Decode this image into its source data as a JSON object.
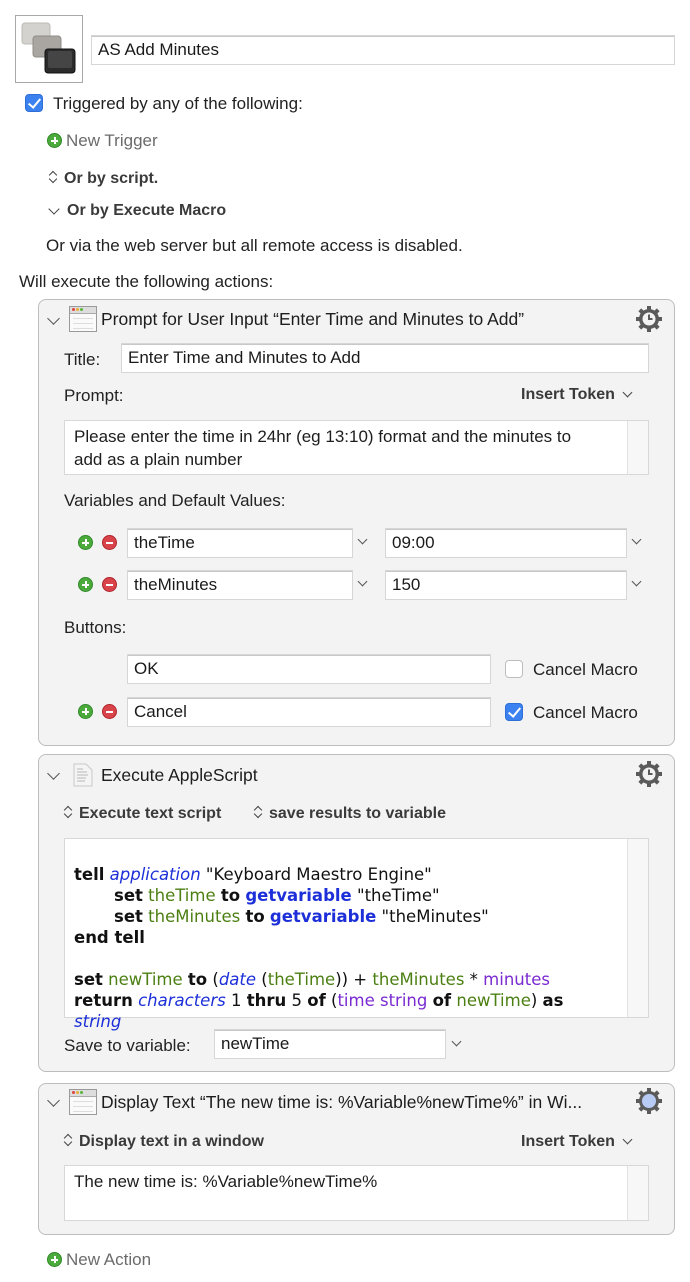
{
  "macro": {
    "icon": "keyboard-keys-icon",
    "name": "AS Add Minutes",
    "triggered_checkbox_label": "Triggered by any of the following:",
    "triggered_checked": true,
    "new_trigger_label": "New Trigger",
    "or_by_script_label": "Or by script.",
    "or_by_execute_macro_label": "Or by Execute Macro",
    "web_server_note": "Or via the web server but all remote access is disabled.",
    "will_execute_label": "Will execute the following actions:",
    "new_action_label": "New Action"
  },
  "actions": [
    {
      "title": "Prompt for User Input “Enter Time and Minutes to Add”",
      "icon": "window-icon",
      "title_label": "Title:",
      "title_value": "Enter Time and Minutes to Add",
      "prompt_label": "Prompt:",
      "insert_token_label": "Insert Token",
      "prompt_text_line1": "Please enter the time in 24hr (eg 13:10) format and the minutes to",
      "prompt_text_line2": "add as a plain number",
      "variables_label": "Variables and Default Values:",
      "variables": [
        {
          "name": "theTime",
          "default": "09:00"
        },
        {
          "name": "theMinutes",
          "default": "150"
        }
      ],
      "buttons_label": "Buttons:",
      "buttons": [
        {
          "label": "OK",
          "cancel_macro_label": "Cancel Macro",
          "cancel_macro": false
        },
        {
          "label": "Cancel",
          "cancel_macro_label": "Cancel Macro",
          "cancel_macro": true
        }
      ]
    },
    {
      "title": "Execute AppleScript",
      "icon": "script-document-icon",
      "mode_label": "Execute text script",
      "result_label": "save results to variable",
      "code": {
        "l1_tell": "tell",
        "l1_application": "application",
        "l1_str": " \"Keyboard Maestro Engine\"",
        "l2_set": "set",
        "l2_var": "theTime",
        "l2_to": "to",
        "l2_cmd": "getvariable",
        "l2_str": " \"theTime\"",
        "l3_set": "set",
        "l3_var": "theMinutes",
        "l3_to": "to",
        "l3_cmd": "getvariable",
        "l3_str": " \"theMinutes\"",
        "l4": "end tell",
        "l5_set": "set",
        "l5_var": "newTime",
        "l5_to": "to",
        "l5_p1": " (",
        "l5_date": "date",
        "l5_p2": " (",
        "l5_var2": "theTime",
        "l5_p3": ")) + ",
        "l5_var3": "theMinutes",
        "l5_p4": " * ",
        "l5_prop": "minutes",
        "l6_return": "return",
        "l6_chars": "characters",
        "l6_n1": " 1 ",
        "l6_thru": "thru",
        "l6_n2": " 5 ",
        "l6_of": "of",
        "l6_p1": " (",
        "l6_prop": "time string",
        "l6_of2": "of",
        "l6_var": "newTime",
        "l6_p2": ") ",
        "l6_as": "as",
        "l7_string": "string"
      },
      "save_to_label": "Save to variable:",
      "save_to_value": "newTime"
    },
    {
      "title": "Display Text “The new time is: %Variable%newTime%” in Wi...",
      "icon": "window-icon",
      "mode_label": "Display text in a window",
      "insert_token_label": "Insert Token",
      "text": "The new time is: %Variable%newTime%"
    }
  ],
  "colors": {
    "checkbox_blue": "#3b82f0",
    "add_green": "#4caa3c",
    "remove_red": "#d9434a",
    "code_var_green": "#4c7f12",
    "code_blue": "#1c2fd8",
    "code_purple": "#7a2ad0",
    "gear_active_blue": "#b7cbf5"
  }
}
